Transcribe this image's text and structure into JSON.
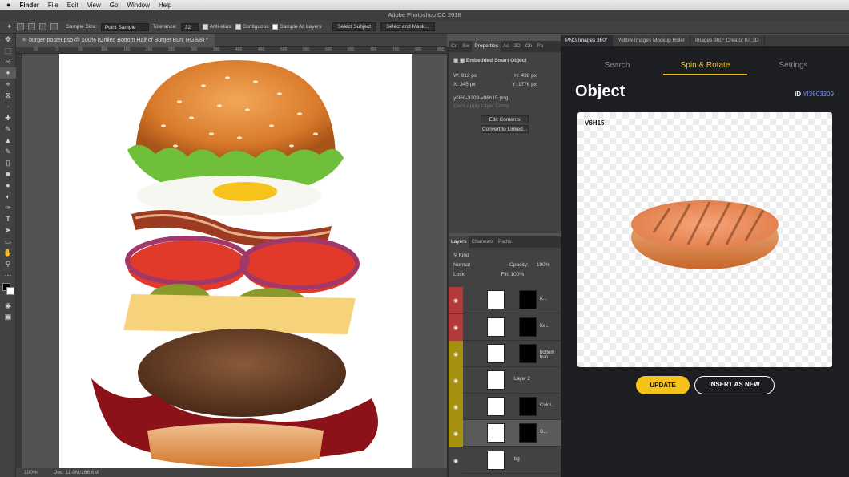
{
  "menubar": {
    "apple": "",
    "app": "Finder",
    "items": [
      "File",
      "Edit",
      "View",
      "Go",
      "Window",
      "Help"
    ]
  },
  "window_title": "Adobe Photoshop CC 2018",
  "options": {
    "sample_size_label": "Sample Size:",
    "sample_size_value": "Point Sample",
    "tolerance_label": "Tolerance:",
    "tolerance_value": "32",
    "anti_alias": "Anti-alias",
    "contiguous": "Contiguous",
    "sample_all": "Sample All Layers",
    "select_subject": "Select Subject",
    "select_mask": "Select and Mask..."
  },
  "document": {
    "tab": "burger-poster.psb @ 100% (Grilled Bottom Half of Burger Bun, RGB/8) *",
    "zoom": "100%",
    "doc_info": "Doc: 11.0M/166.6M",
    "ruler_ticks": [
      "50",
      "0",
      "50",
      "100",
      "150",
      "200",
      "250",
      "300",
      "350",
      "400",
      "450",
      "500",
      "550",
      "600",
      "650",
      "700",
      "750",
      "800",
      "850",
      "900"
    ]
  },
  "properties": {
    "tabs": [
      "Co",
      "Sw",
      "Properties",
      "Ac",
      "3D",
      "Ch",
      "Pa"
    ],
    "type": "Embedded Smart Object",
    "w": "W: 912 px",
    "h": "H: 438 px",
    "x": "X: 345 px",
    "y": "Y: 1776 px",
    "filename": "yi360-3309-v06h15.png",
    "layer_comp": "Don't Apply Layer Comp",
    "edit_contents": "Edit Contents",
    "convert": "Convert to Linked..."
  },
  "layers": {
    "tabs": [
      "Layers",
      "Channels",
      "Paths"
    ],
    "filter": "Kind",
    "blend": "Normal",
    "opacity_label": "Opacity:",
    "opacity": "100%",
    "lock_label": "Lock:",
    "fill_label": "Fill:",
    "fill": "100%",
    "items": [
      {
        "name": "K...",
        "color": "#b33a3a"
      },
      {
        "name": "Ke...",
        "color": "#b33a3a"
      },
      {
        "name": "bottom bun",
        "color": "#a6900f"
      },
      {
        "name": "Layer 2",
        "color": "#a6900f"
      },
      {
        "name": "Color...",
        "color": "#a6900f"
      },
      {
        "name": "G...",
        "color": "#a6900f"
      },
      {
        "name": "bg",
        "color": "#424242"
      }
    ]
  },
  "plugin": {
    "tabs": [
      "PNG Images 360°",
      "Yellow Images Mockup Ruler",
      "Images 360° Creator Kit 3D"
    ],
    "nav": [
      "Search",
      "Spin & Rotate",
      "Settings"
    ],
    "title": "Object",
    "id_label": "ID",
    "id_value": "YI3603309",
    "view_label": "V6H15",
    "update": "UPDATE",
    "insert": "INSERT AS NEW",
    "accent": "#f5c21b"
  }
}
